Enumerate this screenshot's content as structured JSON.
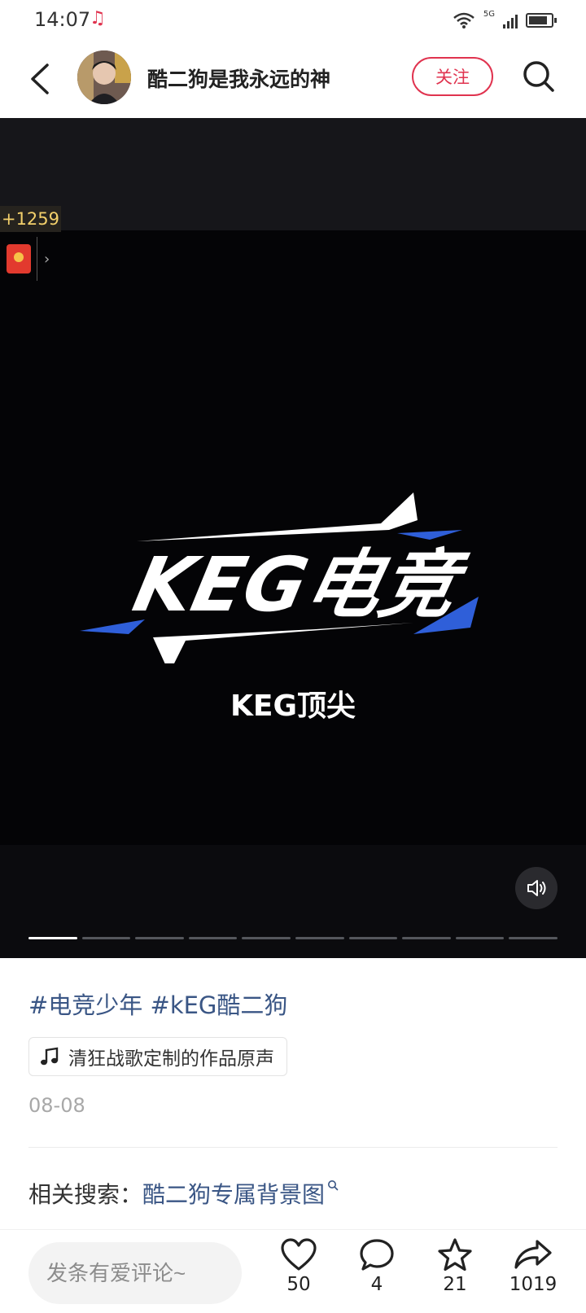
{
  "status_bar": {
    "time": "14:07",
    "network": "5G"
  },
  "header": {
    "author_name": "酷二狗是我永远的神",
    "follow_label": "关注"
  },
  "media": {
    "coin_count": "+1259",
    "redpacket_arrow": "›",
    "logo_text": "KEG电竞",
    "caption": "KEG顶尖",
    "slide_count": 10,
    "active_slide": 1
  },
  "post": {
    "tags": "#电竞少年 #kEG酷二狗",
    "music": "清狂战歌定制的作品原声",
    "date": "08-08",
    "related_label": "相关搜索：",
    "related_query": "酷二狗专属背景图"
  },
  "bottom_bar": {
    "comment_placeholder": "发条有爱评论~",
    "likes": "50",
    "comments": "4",
    "favorites": "21",
    "shares": "1019"
  },
  "colors": {
    "accent": "#e0334f",
    "link": "#3a5685",
    "logo_blue": "#2f5fd9"
  }
}
